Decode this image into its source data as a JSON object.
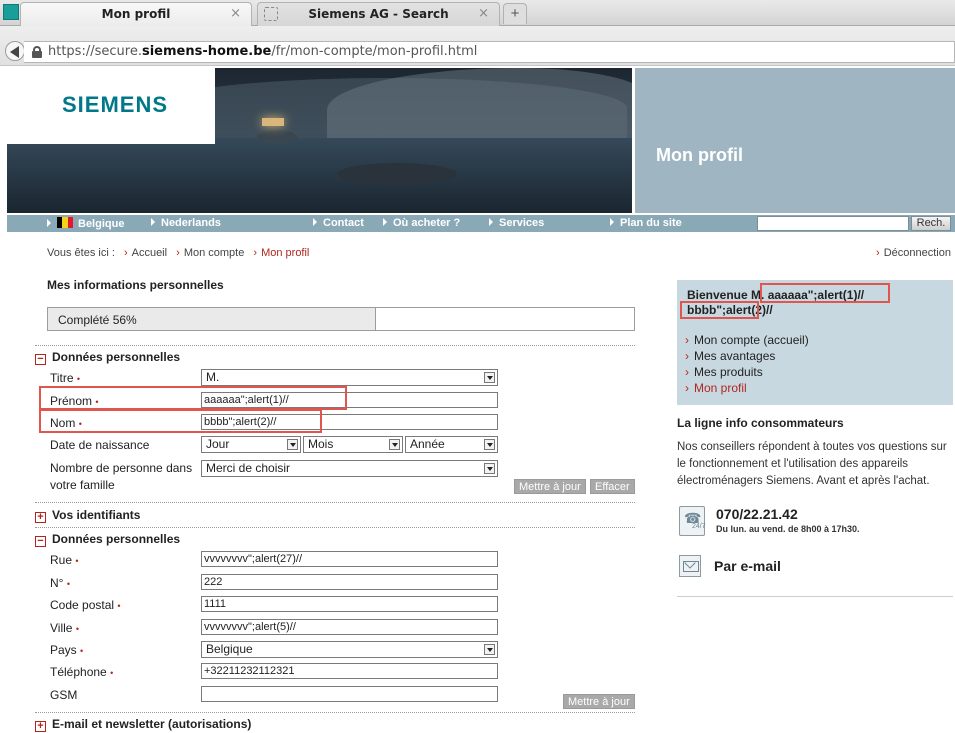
{
  "browser": {
    "tabs": [
      {
        "title": "Mon profil",
        "close": "×"
      },
      {
        "title": "Siemens AG - Search",
        "close": "×"
      }
    ],
    "new_tab": "+",
    "url_prefix": "https://secure.",
    "url_domain": "siemens-home.be",
    "url_path": "/fr/mon-compte/mon-profil.html"
  },
  "banner": {
    "logo": "SIEMENS",
    "title": "Mon profil"
  },
  "nav": {
    "items": [
      "Belgique",
      "Nederlands",
      "Contact",
      "Où acheter ?",
      "Services",
      "Plan du site"
    ],
    "search_button": "Rech."
  },
  "breadcrumb": {
    "prefix": "Vous êtes ici :",
    "items": [
      "Accueil",
      "Mon compte",
      "Mon profil"
    ],
    "logout": "Déconnection"
  },
  "profile": {
    "heading": "Mes informations personnelles",
    "progress_label": "Complété 56%",
    "progress_value": 0.56,
    "section1": {
      "toggle": "−",
      "title": "Données personnelles",
      "titre_label": "Titre",
      "titre_value": "M.",
      "prenom_label": "Prénom",
      "prenom_value": "aaaaaa\";alert(1)//",
      "nom_label": "Nom",
      "nom_value": "bbbb\";alert(2)//",
      "birth_label": "Date de naissance",
      "birth_day": "Jour",
      "birth_month": "Mois",
      "birth_year": "Année",
      "family_label_1": "Nombre de personne dans",
      "family_label_2": "votre famille",
      "family_value": "Merci de choisir",
      "update_button": "Mettre à jour",
      "clear_button": "Effacer"
    },
    "section2": {
      "toggle": "+",
      "title": "Vos identifiants"
    },
    "section3": {
      "toggle": "−",
      "title": "Données personnelles",
      "rue_label": "Rue",
      "rue_value": "vvvvvvvv\";alert(27)//",
      "num_label": "N°",
      "num_value": "222",
      "cp_label": "Code postal",
      "cp_value": "1111",
      "ville_label": "Ville",
      "ville_value": "vvvvvvvv\";alert(5)//",
      "pays_label": "Pays",
      "pays_value": "Belgique",
      "tel_label": "Téléphone",
      "tel_value": "+32211232112321",
      "gsm_label": "GSM",
      "gsm_value": "",
      "update_button": "Mettre à jour"
    },
    "section4": {
      "toggle": "+",
      "title": "E-mail et newsletter (autorisations)"
    },
    "required_mark": "•"
  },
  "sidebar": {
    "welcome_prefix": "Bienvenue M.",
    "welcome_name_1": "aaaaaa\";alert(1)//",
    "welcome_name_2": "bbbb\";alert(2)//",
    "links": [
      "Mon compte (accueil)",
      "Mes avantages",
      "Mes produits",
      "Mon profil"
    ],
    "info_title": "La ligne info consommateurs",
    "info_text": "Nos conseillers répondent à toutes vos questions sur le fonctionnement et l'utilisation des appareils électroménagers Siemens. Avant et après l'achat.",
    "phone": "070/22.21.42",
    "hours": "Du lun. au vend. de 8h00 à 17h30.",
    "email_label": "Par e-mail"
  },
  "colors": {
    "accent_red": "#b0261f",
    "nav_blue": "#8aa9b7",
    "highlight": "#e0564f"
  }
}
